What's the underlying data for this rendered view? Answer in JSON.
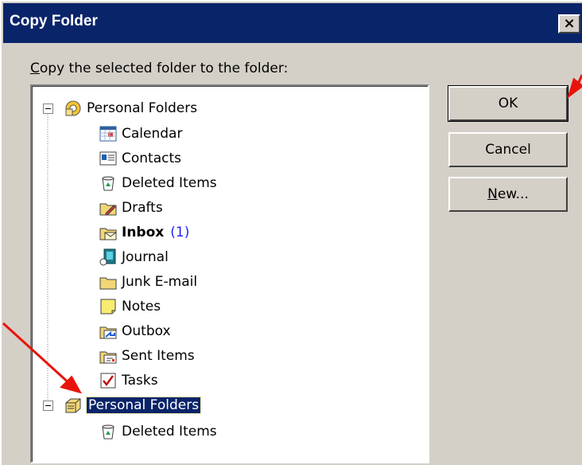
{
  "dialog": {
    "title": "Copy Folder",
    "close_glyph": "×",
    "prompt_prefix": "C",
    "prompt_rest": "opy the selected folder to the folder:"
  },
  "tree": {
    "root1": {
      "label": "Personal Folders",
      "icon": "personal-folders-icon"
    },
    "items": [
      {
        "label": "Calendar",
        "icon": "calendar-icon"
      },
      {
        "label": "Contacts",
        "icon": "contacts-icon"
      },
      {
        "label": "Deleted Items",
        "icon": "deleted-items-icon"
      },
      {
        "label": "Drafts",
        "icon": "drafts-icon"
      },
      {
        "label": "Inbox",
        "count": "(1)",
        "icon": "inbox-icon"
      },
      {
        "label": "Journal",
        "icon": "journal-icon"
      },
      {
        "label": "Junk E-mail",
        "icon": "folder-icon"
      },
      {
        "label": "Notes",
        "icon": "notes-icon"
      },
      {
        "label": "Outbox",
        "icon": "outbox-icon"
      },
      {
        "label": "Sent Items",
        "icon": "sent-items-icon"
      },
      {
        "label": "Tasks",
        "icon": "tasks-icon"
      }
    ],
    "root2": {
      "label": "Personal Folders",
      "icon": "personal-folders-icon",
      "selected": true
    },
    "root2_items": [
      {
        "label": "Deleted Items",
        "icon": "deleted-items-icon"
      }
    ]
  },
  "buttons": {
    "ok": "OK",
    "cancel": "Cancel",
    "new_prefix": "N",
    "new_rest": "ew..."
  },
  "colors": {
    "titlebar": "#0a246a",
    "dialog_bg": "#d4d0c8",
    "selection": "#0a246a",
    "annotation_arrow": "#e8140c"
  }
}
